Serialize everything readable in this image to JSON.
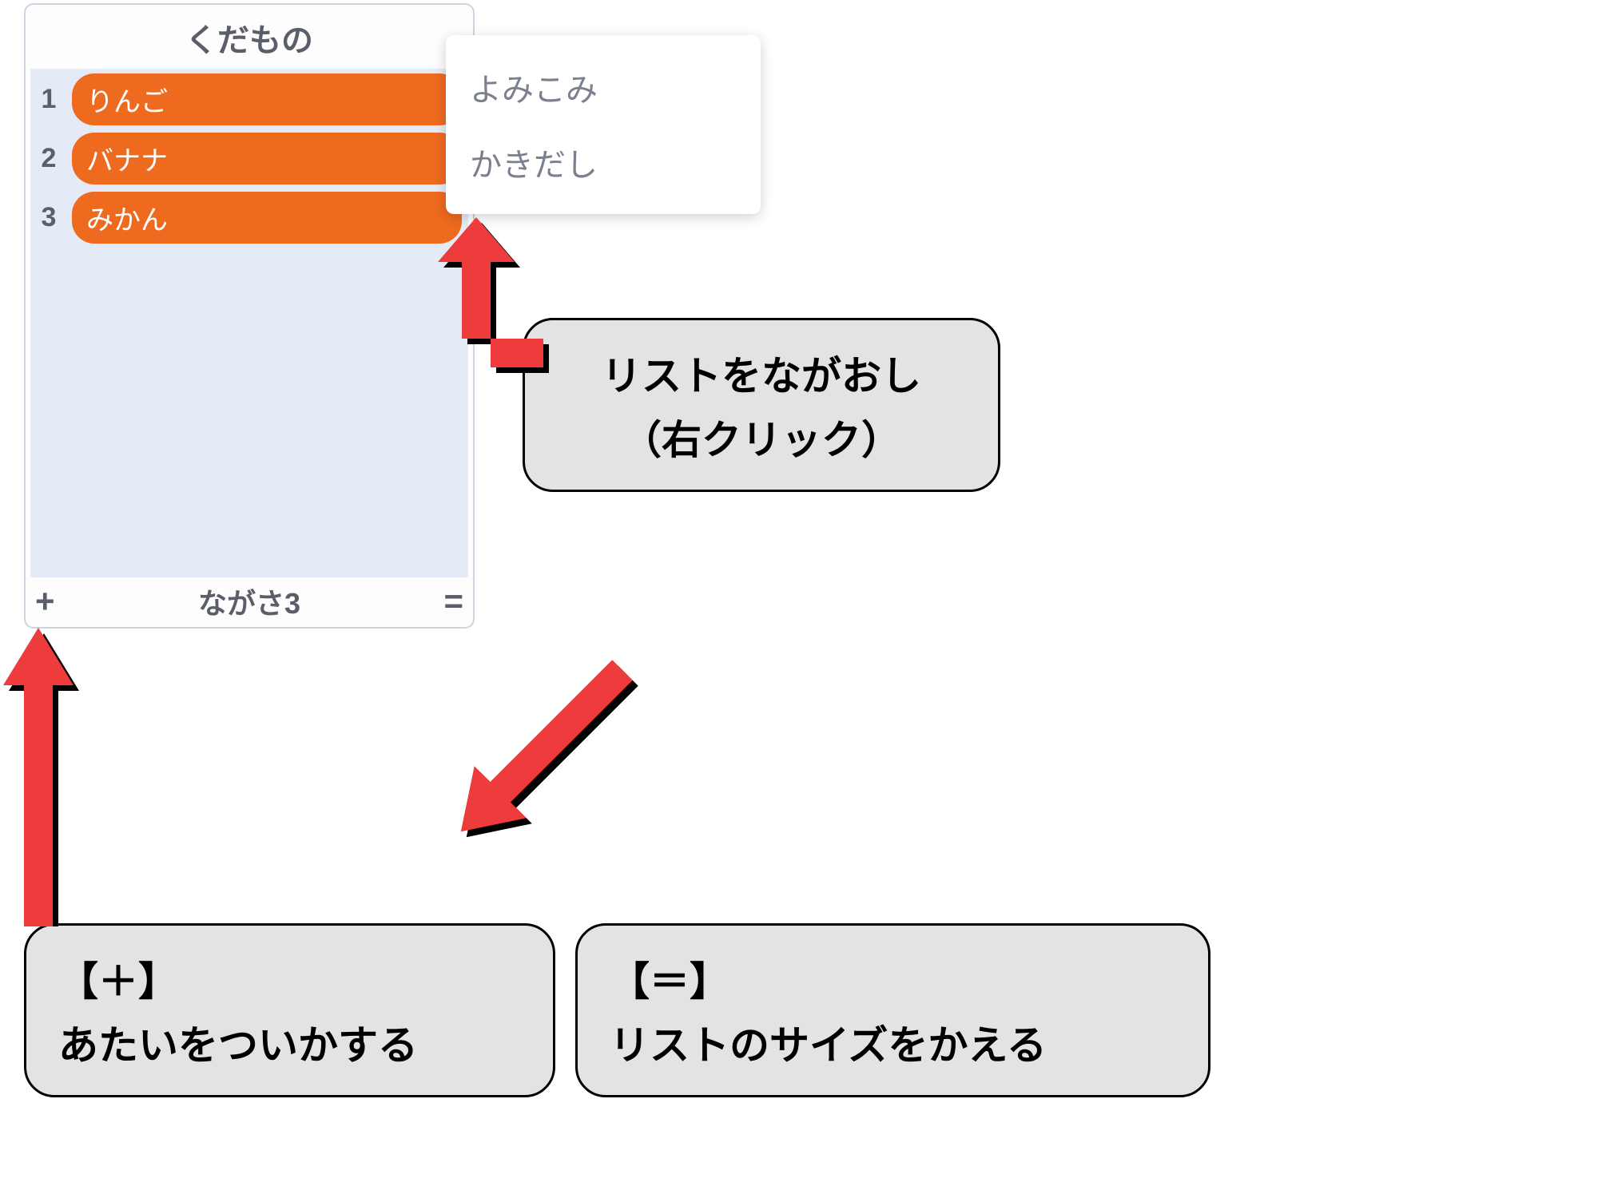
{
  "list": {
    "title": "くだもの",
    "items": [
      {
        "num": "1",
        "label": "りんご"
      },
      {
        "num": "2",
        "label": "バナナ"
      },
      {
        "num": "3",
        "label": "みかん"
      }
    ],
    "add_symbol": "+",
    "length_label": "ながさ3",
    "resize_symbol": "="
  },
  "context_menu": {
    "items": [
      {
        "label": "よみこみ"
      },
      {
        "label": "かきだし"
      }
    ]
  },
  "callouts": {
    "ctx": {
      "line1": "リストをながおし",
      "line2": "（右クリック）"
    },
    "plus": {
      "line1": "【＋】",
      "line2": "あたいをついかする"
    },
    "eq": {
      "line1": "【＝】",
      "line2": "リストのサイズをかえる"
    }
  },
  "colors": {
    "pill": "#ee6a1f",
    "arrow_fill": "#ee3b3b"
  }
}
